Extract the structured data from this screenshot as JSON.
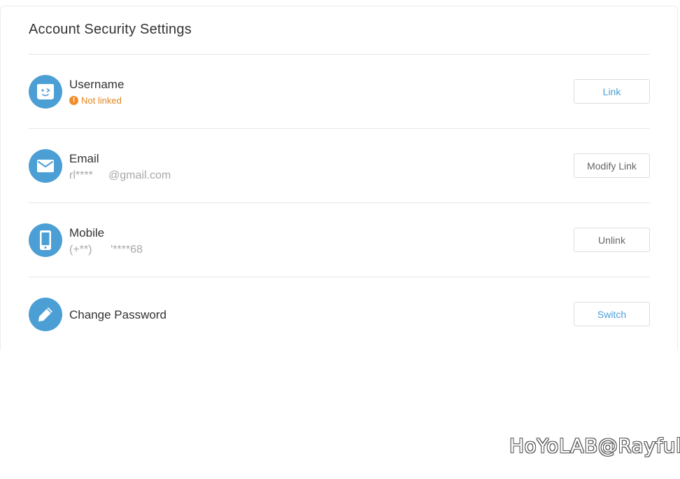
{
  "page_title": "Account Security Settings",
  "colors": {
    "accent": "#4b9fd5",
    "warning": "#ef8d2a",
    "text": "#333333",
    "muted": "#a8a8a8"
  },
  "rows": [
    {
      "icon": "face-icon",
      "label": "Username",
      "status": "Not linked",
      "button": "Link"
    },
    {
      "icon": "envelope-icon",
      "label": "Email",
      "value": "rl****     @gmail.com",
      "button": "Modify Link"
    },
    {
      "icon": "phone-icon",
      "label": "Mobile",
      "value": "(+**)      '****68",
      "button": "Unlink"
    },
    {
      "icon": "pencil-icon",
      "label": "Change Password",
      "button": "Switch"
    }
  ],
  "watermark": "HoYoLAB@Rayful"
}
